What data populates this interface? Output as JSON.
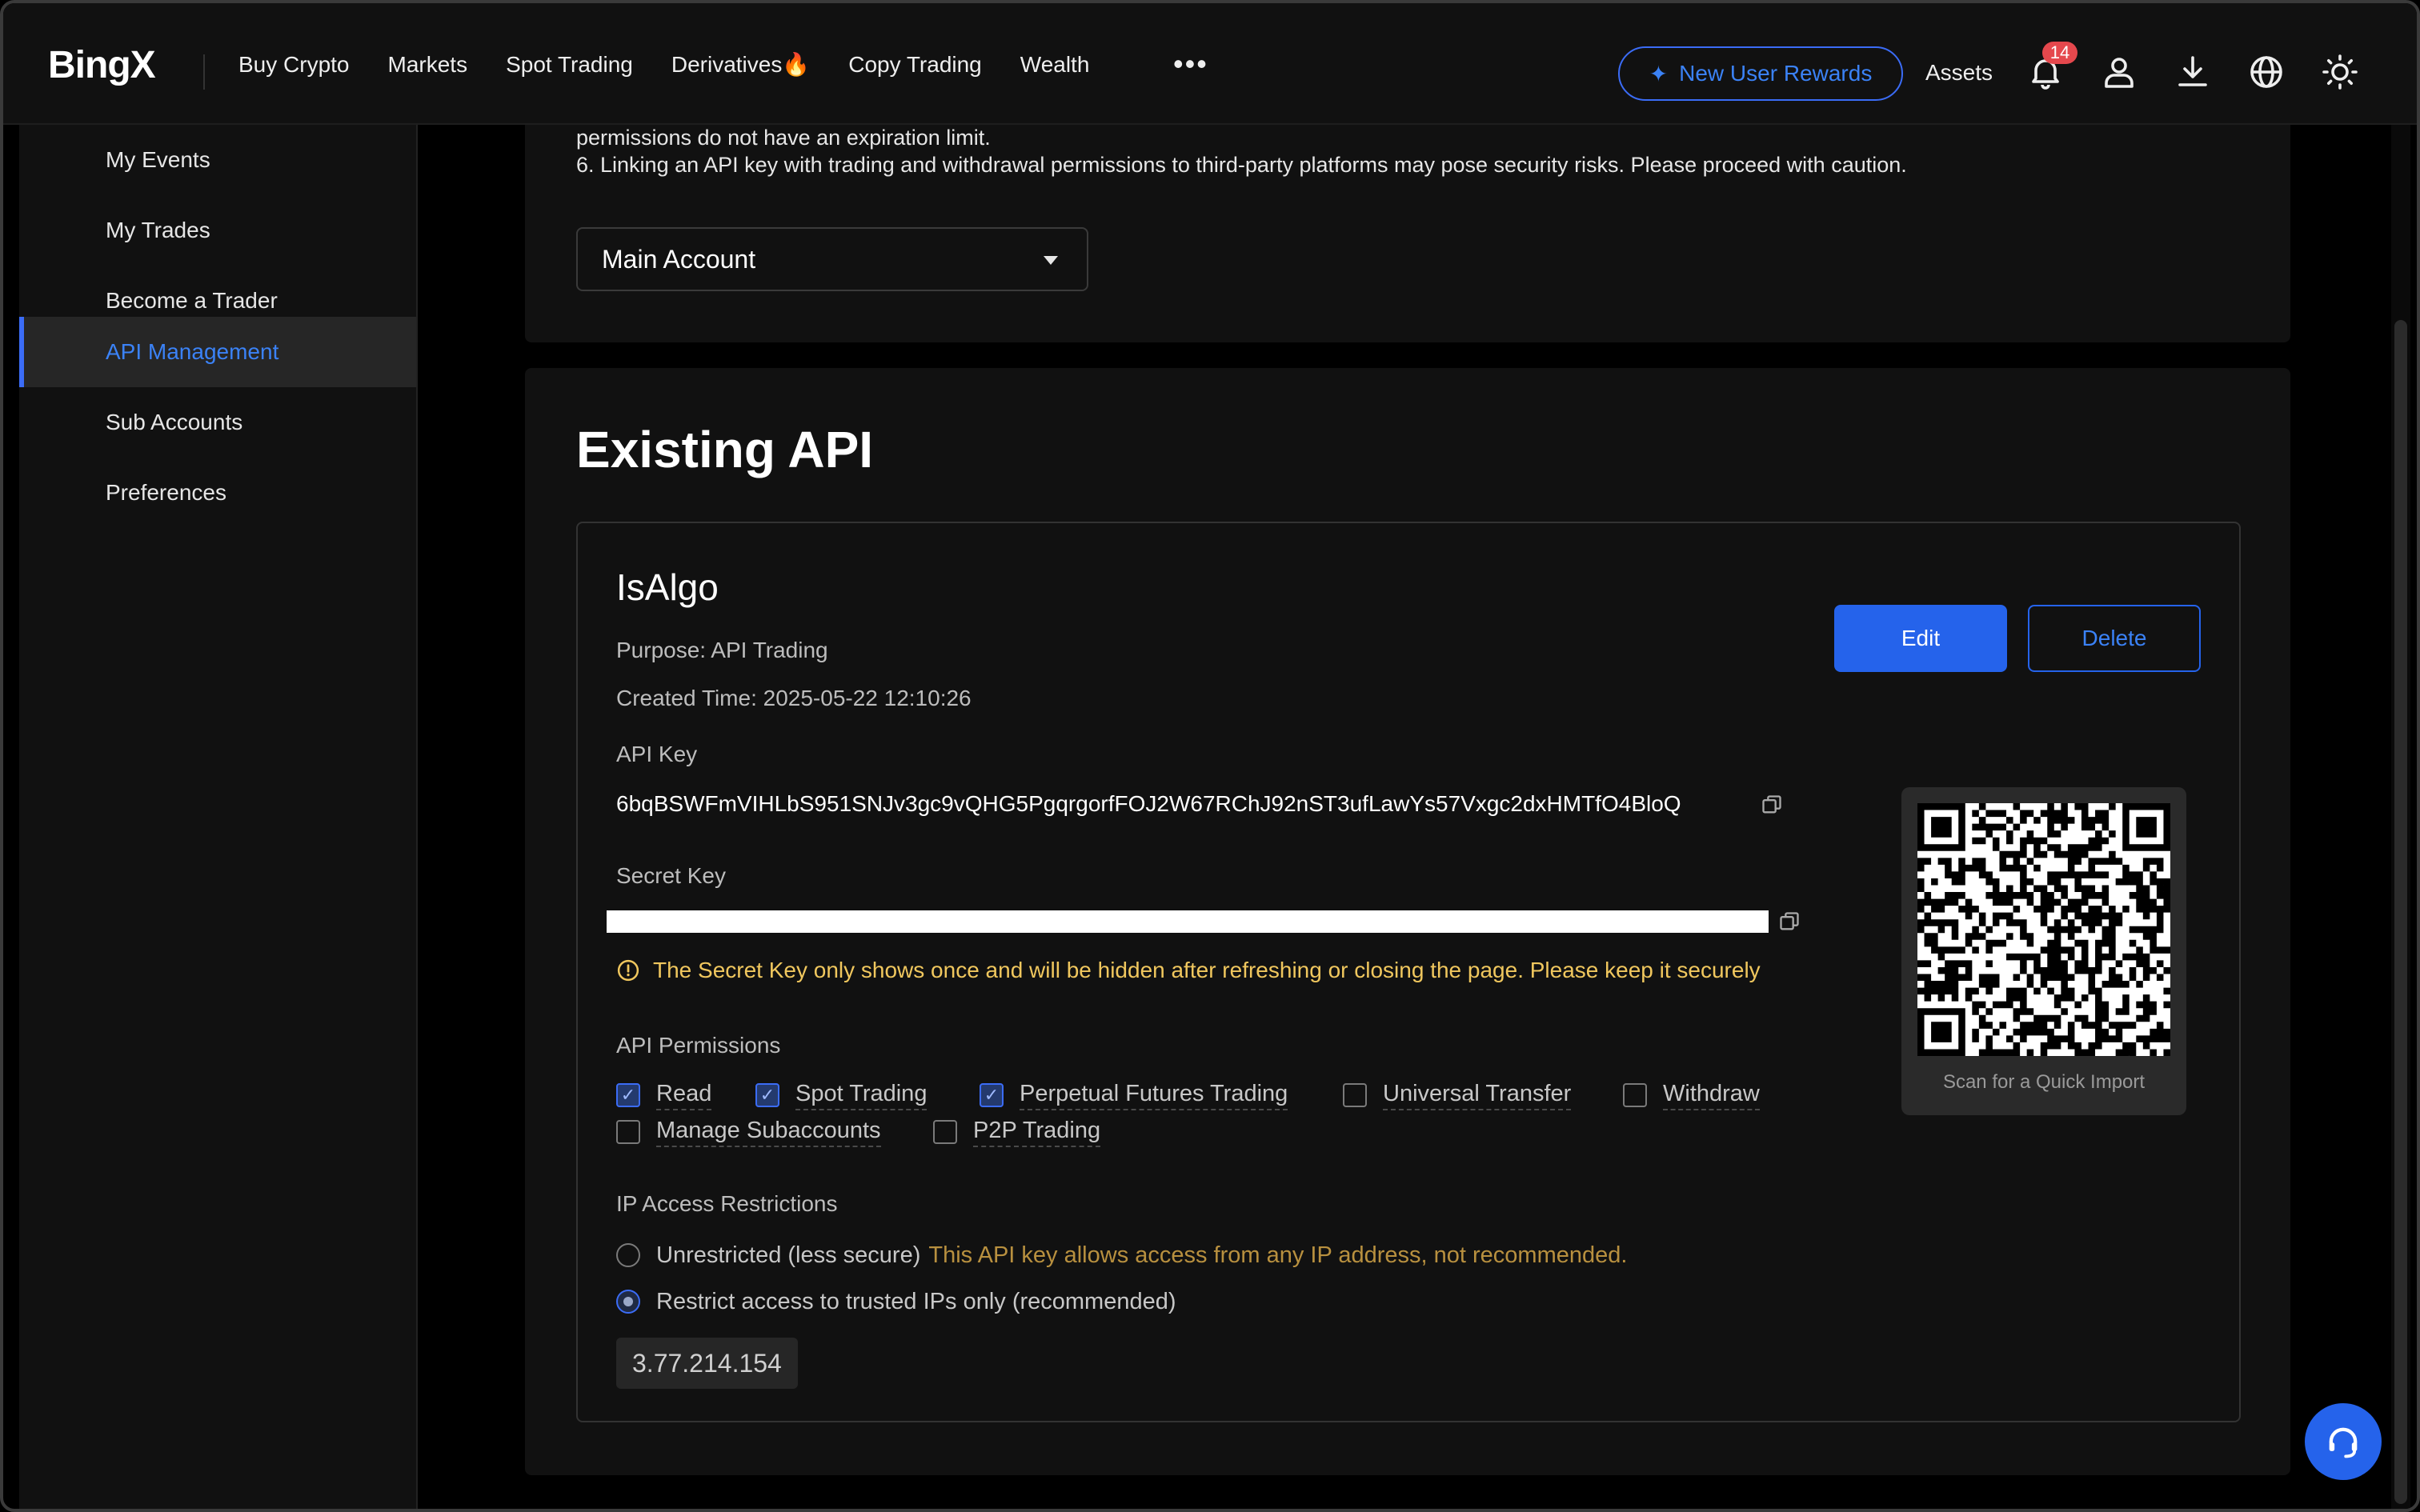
{
  "nav": {
    "logo": "BingX",
    "links": [
      "Buy Crypto",
      "Markets",
      "Spot Trading",
      "Derivatives🔥",
      "Copy Trading",
      "Wealth"
    ],
    "more": "•••",
    "rewards": "New User Rewards",
    "assets": "Assets",
    "notification_count": "14",
    "icons": [
      "bell-icon",
      "user-icon",
      "download-icon",
      "globe-icon",
      "sun-icon"
    ]
  },
  "sidebar": {
    "items": [
      {
        "label": "My Events",
        "active": false
      },
      {
        "label": "My Trades",
        "active": false
      },
      {
        "label": "Become a Trader",
        "active": false
      },
      {
        "label": "API Management",
        "active": true
      },
      {
        "label": "Sub Accounts",
        "active": false
      },
      {
        "label": "Preferences",
        "active": false
      }
    ]
  },
  "notice": {
    "line_a": "permissions do not have an expiration limit.",
    "line_b": "6. Linking an API key with trading and withdrawal permissions to third-party platforms may pose security risks. Please proceed with caution."
  },
  "account_select": {
    "value": "Main Account"
  },
  "existing": {
    "title": "Existing API",
    "name": "IsAlgo",
    "purpose": "Purpose: API Trading",
    "created": "Created Time: 2025-05-22 12:10:26",
    "edit_label": "Edit",
    "delete_label": "Delete",
    "api_key_label": "API Key",
    "api_key": "6bqBSWFmVIHLbS951SNJv3gc9vQHG5PgqrgorfFOJ2W67RChJ92nST3ufLawYs57Vxgc2dxHMTfO4BloQ",
    "secret_key_label": "Secret Key",
    "secret_warning": "The Secret Key only shows once and will be hidden after refreshing or closing the page. Please keep it securely",
    "qr_caption": "Scan for a Quick Import",
    "permissions_label": "API Permissions",
    "permissions": [
      {
        "label": "Read",
        "checked": true
      },
      {
        "label": "Spot Trading",
        "checked": true
      },
      {
        "label": "Perpetual Futures Trading",
        "checked": true
      },
      {
        "label": "Universal Transfer",
        "checked": false
      },
      {
        "label": "Withdraw",
        "checked": false
      },
      {
        "label": "Manage Subaccounts",
        "checked": false
      },
      {
        "label": "P2P Trading",
        "checked": false
      }
    ],
    "ip_label": "IP Access Restrictions",
    "ip_unrestricted": "Unrestricted (less secure)",
    "ip_unrestricted_hint": "This API key allows access from any IP address, not recommended.",
    "ip_restricted": "Restrict access to trusted IPs only (recommended)",
    "ip_value": "3.77.214.154"
  },
  "colors": {
    "accent": "#2563eb",
    "warning": "#f0c75e",
    "hint": "#b8903f",
    "background": "#111111"
  }
}
